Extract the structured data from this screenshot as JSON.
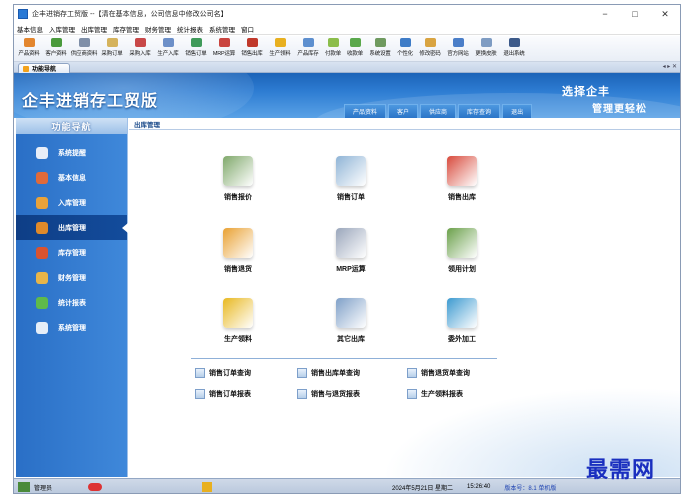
{
  "window": {
    "title": "企丰进销存工贸版 --【清在基本信息，公司信息中修改公司名】",
    "minimize": "−",
    "maximize": "□",
    "close": "✕"
  },
  "menu": [
    "基本信息",
    "入库管理",
    "出库管理",
    "库存管理",
    "财务管理",
    "统计报表",
    "系统管理",
    "窗口"
  ],
  "toolbar": [
    {
      "label": "产品资料",
      "color": "#e3862e"
    },
    {
      "label": "客户资料",
      "color": "#4a9a3c"
    },
    {
      "label": "供应商资料",
      "color": "#7f8fa8"
    },
    {
      "label": "采购订单",
      "color": "#d5b35c"
    },
    {
      "label": "采购入库",
      "color": "#c84848"
    },
    {
      "label": "生产入库",
      "color": "#6c8fc8"
    },
    {
      "label": "销售订单",
      "color": "#3f9a5a"
    },
    {
      "label": "MRP运算",
      "color": "#c9443f"
    },
    {
      "label": "销售出库",
      "color": "#c0392b"
    },
    {
      "label": "生产领料",
      "color": "#e8b020"
    },
    {
      "label": "产品库存",
      "color": "#5d8fcf"
    },
    {
      "label": "付款单",
      "color": "#8bbd4b"
    },
    {
      "label": "收款单",
      "color": "#5aa84c"
    },
    {
      "label": "系统设置",
      "color": "#6f9a5f"
    },
    {
      "label": "个性化",
      "color": "#3e7cc7"
    },
    {
      "label": "修改密码",
      "color": "#d9a441"
    },
    {
      "label": "官方网站",
      "color": "#4a7ec8"
    },
    {
      "label": "更换皮肤",
      "color": "#7e9cc3"
    },
    {
      "label": "退出系统",
      "color": "#3c5a8a"
    }
  ],
  "tab": {
    "label": "功能导航",
    "nav": "◂ ▸ ✕"
  },
  "banner": {
    "brand": "企丰进销存工贸版",
    "slogan1": "选择企丰",
    "slogan2": "管理更轻松",
    "topnav": [
      "产品资料",
      "客户",
      "供应商",
      "库存查询",
      "退出"
    ]
  },
  "sidebar": {
    "title": "功能导航",
    "items": [
      {
        "label": "系统提醒",
        "color": "#e8eef8"
      },
      {
        "label": "基本信息",
        "color": "#e06a3a"
      },
      {
        "label": "入库管理",
        "color": "#e9a23a"
      },
      {
        "label": "出库管理",
        "color": "#e08a2a"
      },
      {
        "label": "库存管理",
        "color": "#d9532f"
      },
      {
        "label": "财务管理",
        "color": "#e7b54a"
      },
      {
        "label": "统计报表",
        "color": "#5fba4a"
      },
      {
        "label": "系统管理",
        "color": "#e6eef8"
      }
    ]
  },
  "content": {
    "breadcrumb": "出库管理",
    "big_buttons": [
      {
        "label": "销售报价",
        "color": "#7fa86a"
      },
      {
        "label": "销售订单",
        "color": "#8fb4d6"
      },
      {
        "label": "销售出库",
        "color": "#d84a3c"
      },
      {
        "label": "销售退货",
        "color": "#e9a132"
      },
      {
        "label": "MRP运算",
        "color": "#9aa6bb"
      },
      {
        "label": "领用计划",
        "color": "#6aa04a"
      },
      {
        "label": "生产领料",
        "color": "#e8b820"
      },
      {
        "label": "其它出库",
        "color": "#7fa0c8"
      },
      {
        "label": "委外加工",
        "color": "#3c9ad0"
      }
    ],
    "small_buttons": [
      "销售订单查询",
      "销售出库单查询",
      "销售退货单查询",
      "销售订单报表",
      "销售与退货报表",
      "生产领料报表"
    ]
  },
  "status": {
    "user": "管理员",
    "datetime": "2024年5月21日  星期二",
    "time": "15:26:40",
    "version": "版本号：8.1 单机版"
  },
  "watermark": "最需网"
}
